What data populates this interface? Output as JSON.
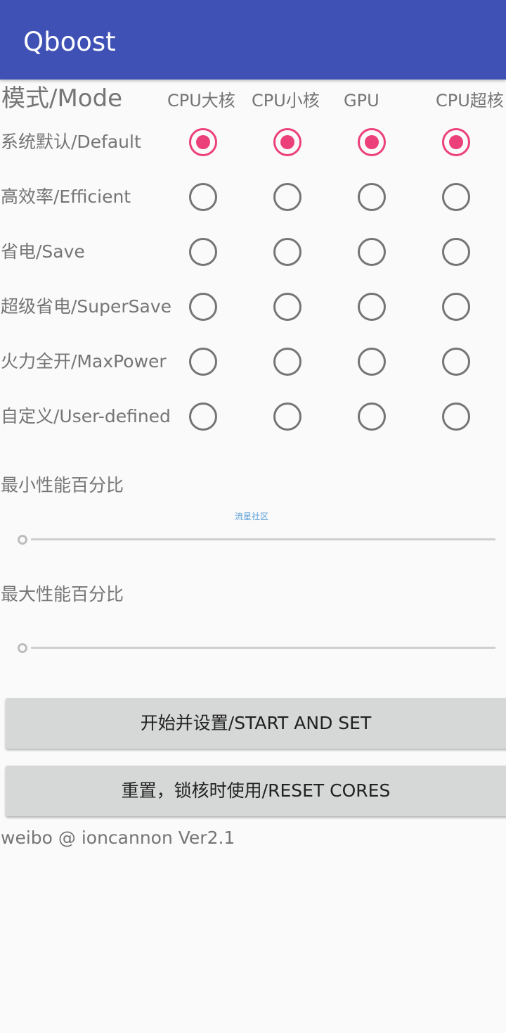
{
  "appbar": {
    "title": "Qboost",
    "color": "#3f51b5"
  },
  "mode_header": "模式/Mode",
  "columns": [
    "CPU大核",
    "CPU小核",
    "GPU",
    "CPU超核"
  ],
  "rows": [
    {
      "label": "系统默认/Default",
      "selected": [
        true,
        true,
        true,
        true
      ]
    },
    {
      "label": "高效率/Efficient",
      "selected": [
        false,
        false,
        false,
        false
      ]
    },
    {
      "label": "省电/Save",
      "selected": [
        false,
        false,
        false,
        false
      ]
    },
    {
      "label": "超级省电/SuperSave",
      "selected": [
        false,
        false,
        false,
        false
      ]
    },
    {
      "label": "火力全开/MaxPower",
      "selected": [
        false,
        false,
        false,
        false
      ]
    },
    {
      "label": "自定义/User-defined",
      "selected": [
        false,
        false,
        false,
        false
      ]
    }
  ],
  "min_perf": {
    "label": "最小性能百分比",
    "value_percent": 0
  },
  "watermark": "流星社区",
  "max_perf": {
    "label": "最大性能百分比",
    "value_percent": 0
  },
  "buttons": {
    "start": "开始并设置/START AND SET",
    "reset": "重置，锁核时使用/RESET CORES"
  },
  "footer": "weibo @ ioncannon Ver2.1",
  "accent_color": "#ec407a"
}
